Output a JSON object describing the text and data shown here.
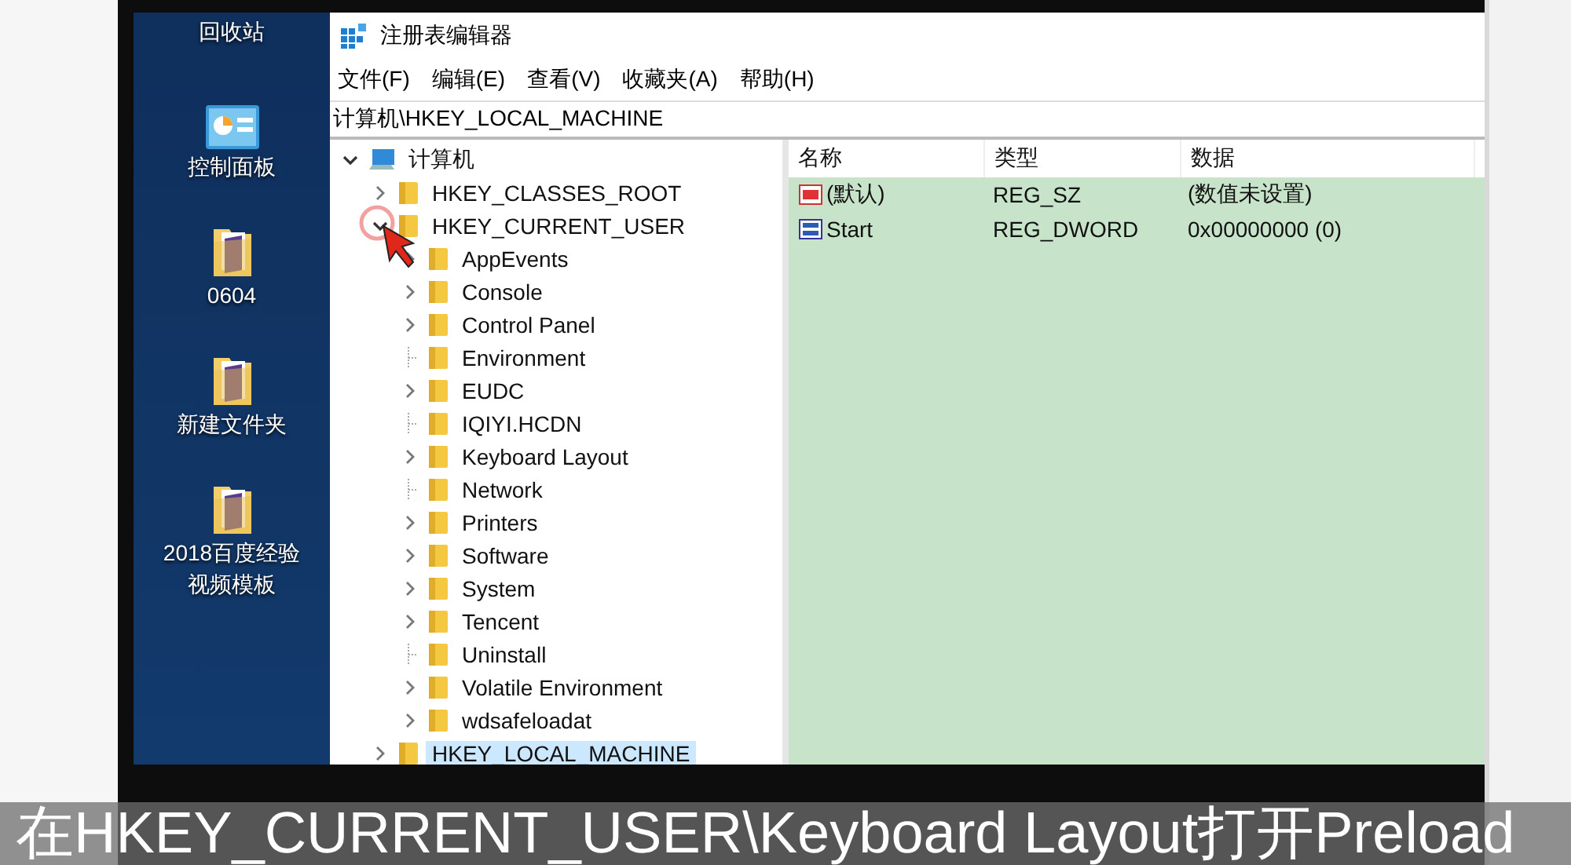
{
  "desktop": {
    "icons": [
      {
        "label": "回收站",
        "kind": "text"
      },
      {
        "label": "控制面板",
        "kind": "control-panel"
      },
      {
        "label": "0604",
        "kind": "file-folder"
      },
      {
        "label": "新建文件夹",
        "kind": "file-folder"
      },
      {
        "label": "2018百度经验视频模板",
        "kind": "file-folder"
      }
    ]
  },
  "window": {
    "title": "注册表编辑器",
    "menu": [
      "文件(F)",
      "编辑(E)",
      "查看(V)",
      "收藏夹(A)",
      "帮助(H)"
    ],
    "address": "计算机\\HKEY_LOCAL_MACHINE",
    "tree": {
      "label": "计算机",
      "expanded": true,
      "selected": false,
      "children": [
        {
          "label": "HKEY_CLASSES_ROOT",
          "has_children": true,
          "expanded": false,
          "selected": false
        },
        {
          "label": "HKEY_CURRENT_USER",
          "has_children": true,
          "expanded": true,
          "selected": false,
          "children": [
            {
              "label": "AppEvents",
              "has_children": true,
              "expanded": false,
              "selected": false
            },
            {
              "label": "Console",
              "has_children": true,
              "expanded": false,
              "selected": false
            },
            {
              "label": "Control Panel",
              "has_children": true,
              "expanded": false,
              "selected": false
            },
            {
              "label": "Environment",
              "has_children": false,
              "expanded": false,
              "selected": false
            },
            {
              "label": "EUDC",
              "has_children": true,
              "expanded": false,
              "selected": false
            },
            {
              "label": "IQIYI.HCDN",
              "has_children": false,
              "expanded": false,
              "selected": false
            },
            {
              "label": "Keyboard Layout",
              "has_children": true,
              "expanded": false,
              "selected": false
            },
            {
              "label": "Network",
              "has_children": false,
              "expanded": false,
              "selected": false
            },
            {
              "label": "Printers",
              "has_children": true,
              "expanded": false,
              "selected": false
            },
            {
              "label": "Software",
              "has_children": true,
              "expanded": false,
              "selected": false
            },
            {
              "label": "System",
              "has_children": true,
              "expanded": false,
              "selected": false
            },
            {
              "label": "Tencent",
              "has_children": true,
              "expanded": false,
              "selected": false
            },
            {
              "label": "Uninstall",
              "has_children": false,
              "expanded": false,
              "selected": false
            },
            {
              "label": "Volatile Environment",
              "has_children": true,
              "expanded": false,
              "selected": false
            },
            {
              "label": "wdsafeloadat",
              "has_children": true,
              "expanded": false,
              "selected": false
            }
          ]
        },
        {
          "label": "HKEY_LOCAL_MACHINE",
          "has_children": true,
          "expanded": false,
          "selected": true
        }
      ]
    },
    "values": {
      "columns": [
        "名称",
        "类型",
        "数据"
      ],
      "rows": [
        {
          "name": "(默认)",
          "type": "REG_SZ",
          "data": "(数值未设置)",
          "kind": "string"
        },
        {
          "name": "Start",
          "type": "REG_DWORD",
          "data": "0x00000000 (0)",
          "kind": "binary"
        }
      ]
    }
  },
  "subtitle": "在HKEY_CURRENT_USER\\Keyboard Layout打开Preload"
}
